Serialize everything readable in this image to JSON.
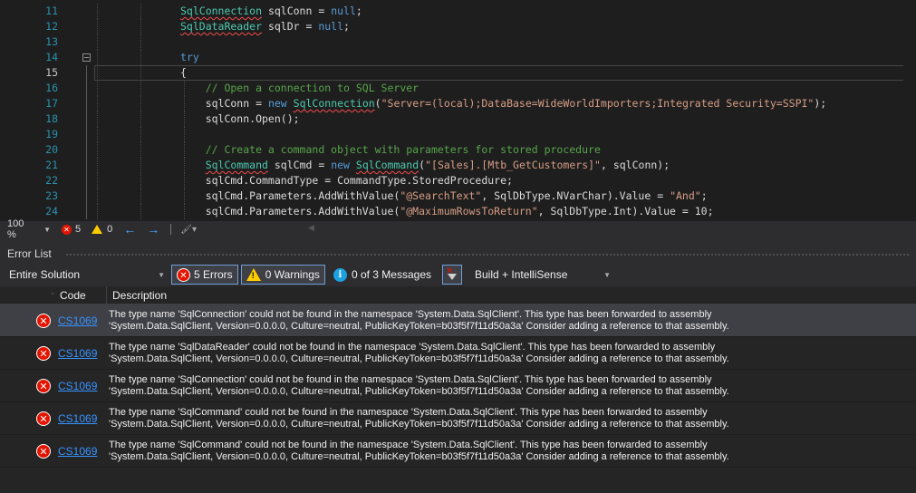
{
  "editor": {
    "lines": [
      {
        "num": "11",
        "indent": 1,
        "tokens": [
          {
            "t": "SqlConnection",
            "c": "ty",
            "squig": true
          },
          {
            "t": " sqlConn = ",
            "c": ""
          },
          {
            "t": "null",
            "c": "kw"
          },
          {
            "t": ";",
            "c": ""
          }
        ]
      },
      {
        "num": "12",
        "indent": 1,
        "tokens": [
          {
            "t": "SqlDataReader",
            "c": "ty",
            "squig": true
          },
          {
            "t": " sqlDr = ",
            "c": ""
          },
          {
            "t": "null",
            "c": "kw"
          },
          {
            "t": ";",
            "c": ""
          }
        ]
      },
      {
        "num": "13",
        "indent": 1,
        "tokens": []
      },
      {
        "num": "14",
        "indent": 1,
        "fold": true,
        "tokens": [
          {
            "t": "try",
            "c": "kw"
          }
        ]
      },
      {
        "num": "15",
        "indent": 1,
        "current": true,
        "tokens": [
          {
            "t": "{",
            "c": ""
          }
        ]
      },
      {
        "num": "16",
        "indent": 2,
        "tokens": [
          {
            "t": "    // Open a connection to SQL Server",
            "c": "cm"
          }
        ]
      },
      {
        "num": "17",
        "indent": 2,
        "tokens": [
          {
            "t": "    sqlConn = ",
            "c": ""
          },
          {
            "t": "new",
            "c": "kw"
          },
          {
            "t": " ",
            "c": ""
          },
          {
            "t": "SqlConnection",
            "c": "ty",
            "squig": true
          },
          {
            "t": "(",
            "c": ""
          },
          {
            "t": "\"Server=(local);DataBase=WideWorldImporters;Integrated Security=SSPI\"",
            "c": "str"
          },
          {
            "t": ");",
            "c": ""
          }
        ]
      },
      {
        "num": "18",
        "indent": 2,
        "tokens": [
          {
            "t": "    sqlConn.Open();",
            "c": ""
          }
        ]
      },
      {
        "num": "19",
        "indent": 2,
        "tokens": []
      },
      {
        "num": "20",
        "indent": 2,
        "tokens": [
          {
            "t": "    // Create a command object with parameters for stored procedure",
            "c": "cm"
          }
        ]
      },
      {
        "num": "21",
        "indent": 2,
        "tokens": [
          {
            "t": "    ",
            "c": ""
          },
          {
            "t": "SqlCommand",
            "c": "ty",
            "squig": true
          },
          {
            "t": " sqlCmd = ",
            "c": ""
          },
          {
            "t": "new",
            "c": "kw"
          },
          {
            "t": " ",
            "c": ""
          },
          {
            "t": "SqlCommand",
            "c": "ty",
            "squig": true
          },
          {
            "t": "(",
            "c": ""
          },
          {
            "t": "\"[Sales].[Mtb_GetCustomers]\"",
            "c": "str"
          },
          {
            "t": ", sqlConn);",
            "c": ""
          }
        ]
      },
      {
        "num": "22",
        "indent": 2,
        "tokens": [
          {
            "t": "    sqlCmd.CommandType = CommandType.StoredProcedure;",
            "c": ""
          }
        ]
      },
      {
        "num": "23",
        "indent": 2,
        "tokens": [
          {
            "t": "    sqlCmd.Parameters.AddWithValue(",
            "c": ""
          },
          {
            "t": "\"@SearchText\"",
            "c": "str"
          },
          {
            "t": ", SqlDbType.NVarChar).Value = ",
            "c": ""
          },
          {
            "t": "\"And\"",
            "c": "str"
          },
          {
            "t": ";",
            "c": ""
          }
        ]
      },
      {
        "num": "24",
        "indent": 2,
        "tokens": [
          {
            "t": "    sqlCmd.Parameters.AddWithValue(",
            "c": ""
          },
          {
            "t": "\"@MaximumRowsToReturn\"",
            "c": "str"
          },
          {
            "t": ", SqlDbType.Int).Value = 10;",
            "c": ""
          }
        ]
      }
    ]
  },
  "statusbar": {
    "zoom": "100 %",
    "error_count": "5",
    "warning_count": "0"
  },
  "error_list": {
    "title": "Error List",
    "scope": "Entire Solution",
    "errors_label": "5 Errors",
    "warnings_label": "0 Warnings",
    "messages_label": "0 of 3 Messages",
    "build_filter": "Build + IntelliSense",
    "columns": {
      "code": "Code",
      "description": "Description"
    },
    "rows": [
      {
        "code": "CS1069",
        "line1": "The type name 'SqlConnection' could not be found in the namespace 'System.Data.SqlClient'. This type has been forwarded to assembly",
        "line2": "'System.Data.SqlClient, Version=0.0.0.0, Culture=neutral, PublicKeyToken=b03f5f7f11d50a3a' Consider adding a reference to that assembly."
      },
      {
        "code": "CS1069",
        "line1": "The type name 'SqlDataReader' could not be found in the namespace 'System.Data.SqlClient'. This type has been forwarded to assembly",
        "line2": "'System.Data.SqlClient, Version=0.0.0.0, Culture=neutral, PublicKeyToken=b03f5f7f11d50a3a' Consider adding a reference to that assembly."
      },
      {
        "code": "CS1069",
        "line1": "The type name 'SqlConnection' could not be found in the namespace 'System.Data.SqlClient'. This type has been forwarded to assembly",
        "line2": "'System.Data.SqlClient, Version=0.0.0.0, Culture=neutral, PublicKeyToken=b03f5f7f11d50a3a' Consider adding a reference to that assembly."
      },
      {
        "code": "CS1069",
        "line1": "The type name 'SqlCommand' could not be found in the namespace 'System.Data.SqlClient'. This type has been forwarded to assembly",
        "line2": "'System.Data.SqlClient, Version=0.0.0.0, Culture=neutral, PublicKeyToken=b03f5f7f11d50a3a' Consider adding a reference to that assembly."
      },
      {
        "code": "CS1069",
        "line1": "The type name 'SqlCommand' could not be found in the namespace 'System.Data.SqlClient'. This type has been forwarded to assembly",
        "line2": "'System.Data.SqlClient, Version=0.0.0.0, Culture=neutral, PublicKeyToken=b03f5f7f11d50a3a' Consider adding a reference to that assembly."
      }
    ]
  }
}
